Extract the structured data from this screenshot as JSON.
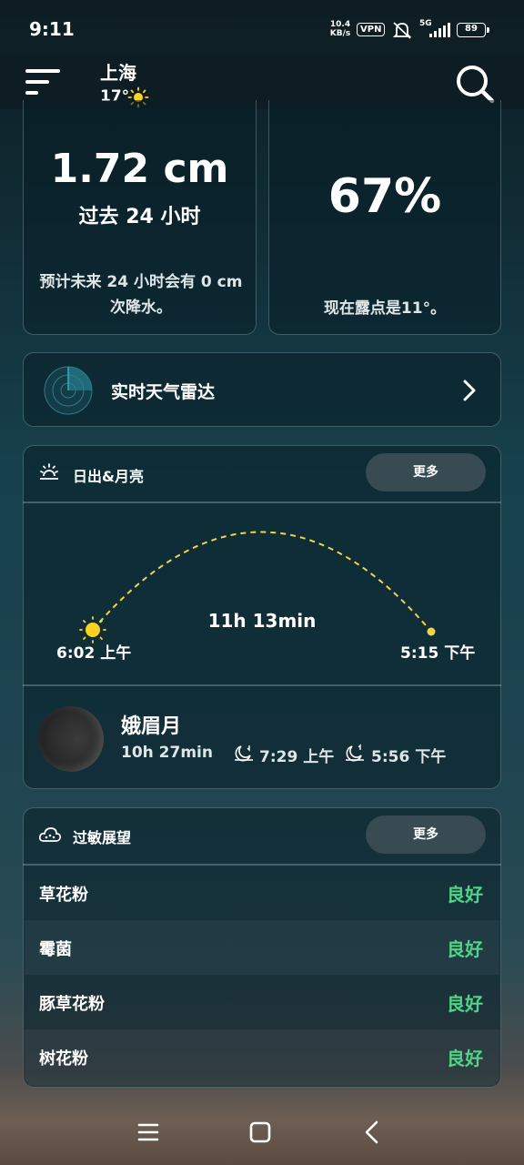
{
  "status_bar": {
    "time": "9:11",
    "net_speed_value": "10.4",
    "net_speed_unit": "KB/s",
    "vpn": "VPN",
    "signal": "5G",
    "battery": "89"
  },
  "header": {
    "city": "上海",
    "temp": "17°",
    "icons": [
      "menu-icon",
      "sun-icon",
      "search-icon"
    ]
  },
  "precip_card": {
    "value": "1.72 cm",
    "period": "过去 24 小时",
    "forecast": "预计未来 24 小时会有 0 cm 次降水。"
  },
  "humidity_card": {
    "value": "67%",
    "dew_point": "现在露点是11°。"
  },
  "radar": {
    "label": "实时天气雷达"
  },
  "sun_moon": {
    "title": "日出&月亮",
    "more": "更多",
    "sunrise": "6:02 上午",
    "sunset": "5:15 下午",
    "day_length": "11h 13min",
    "moon_phase": "娥眉月",
    "moon_length": "10h 27min",
    "moonrise": "7:29 上午",
    "moonset": "5:56 下午"
  },
  "allergy": {
    "title": "过敏展望",
    "more": "更多",
    "rows": [
      {
        "name": "草花粉",
        "level": "良好"
      },
      {
        "name": "霉菌",
        "level": "良好"
      },
      {
        "name": "豚草花粉",
        "level": "良好"
      },
      {
        "name": "树花粉",
        "level": "良好"
      }
    ]
  },
  "colors": {
    "good": "#4fd488",
    "sun": "#ffd21f",
    "arc": "#f2d24a"
  }
}
